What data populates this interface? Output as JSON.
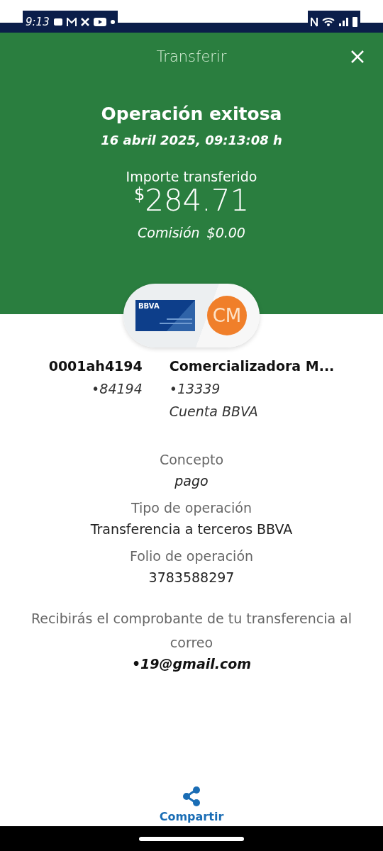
{
  "status_bar": {
    "time": "9:13"
  },
  "header": {
    "title": "Transferir"
  },
  "result": {
    "title": "Operación exitosa",
    "date": "16 abril 2025, 09:13:08 h",
    "amount_label": "Importe transferido",
    "currency": "$",
    "amount": "284.71",
    "commission_label": "Comisión",
    "commission": "$0.00"
  },
  "origin": {
    "card_label": "BBVA",
    "name": "0001ah4194",
    "number": "•84194"
  },
  "destination": {
    "initials": "CM",
    "name": "Comercializadora M...",
    "number": "•13339",
    "account_type": "Cuenta BBVA"
  },
  "details": [
    {
      "label": "Concepto",
      "value": "pago",
      "italic": true
    },
    {
      "label": "Tipo de operación",
      "value": "Transferencia a terceros BBVA",
      "italic": false
    },
    {
      "label": "Folio de operación",
      "value": "3783588297",
      "italic": false
    }
  ],
  "notice": {
    "text": "Recibirás el comprobante de tu transferencia al correo",
    "email": "•19@gmail.com"
  },
  "share": {
    "label": "Compartir"
  }
}
